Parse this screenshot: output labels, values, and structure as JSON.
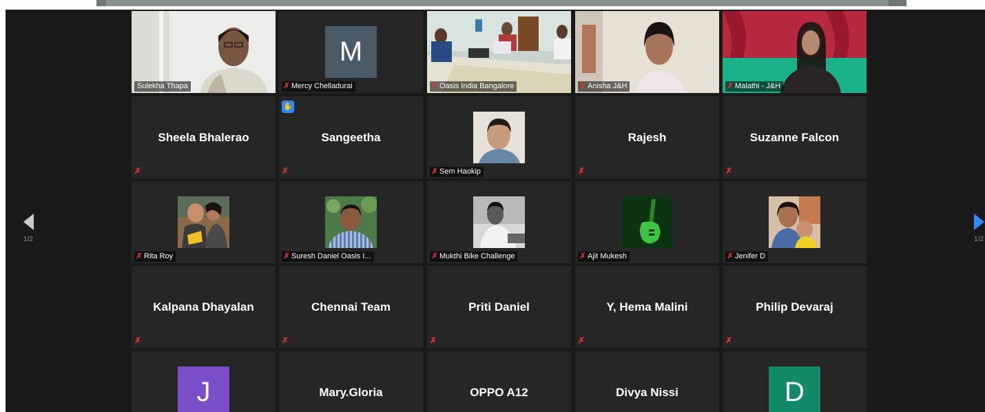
{
  "pager": {
    "left": "1/2",
    "right": "1/2"
  },
  "colors": {
    "accent": "#2d8cff",
    "active_border": "#c7e03a",
    "mic_muted": "#e0312e"
  },
  "tiles": [
    {
      "name": "Sulekha Thapa",
      "kind": "video",
      "active": true
    },
    {
      "name": "Mercy Chelladurai",
      "kind": "avatar",
      "initial": "M",
      "avatar_color": "#4a5a66",
      "muted": true
    },
    {
      "name": "Oasis India Bangalore",
      "kind": "video",
      "muted": true
    },
    {
      "name": "Anisha J&H",
      "kind": "video",
      "muted": true
    },
    {
      "name": "Malathi - J&H",
      "kind": "video",
      "muted": true
    },
    {
      "name": "Sheela Bhalerao",
      "kind": "name",
      "muted": true
    },
    {
      "name": "Sangeetha",
      "kind": "name",
      "muted": true,
      "hand_raised": true
    },
    {
      "name": "Sem Haokip",
      "kind": "photo",
      "muted": true
    },
    {
      "name": "Rajesh",
      "kind": "name",
      "muted": true
    },
    {
      "name": "Suzanne Falcon",
      "kind": "name",
      "muted": true
    },
    {
      "name": "Rita Roy",
      "kind": "photo",
      "muted": true
    },
    {
      "name": "Suresh Daniel Oasis I...",
      "kind": "photo",
      "muted": true
    },
    {
      "name": "Mukthi Bike Challenge",
      "kind": "photo",
      "muted": true
    },
    {
      "name": "Ajit Mukesh",
      "kind": "photo",
      "muted": true
    },
    {
      "name": "Jenifer D",
      "kind": "photo",
      "muted": true
    },
    {
      "name": "Kalpana Dhayalan",
      "kind": "name",
      "muted": true
    },
    {
      "name": "Chennai Team",
      "kind": "name",
      "muted": true
    },
    {
      "name": "Priti Daniel",
      "kind": "name",
      "muted": true
    },
    {
      "name": "Y, Hema Malini",
      "kind": "name",
      "muted": true
    },
    {
      "name": "Philip Devaraj",
      "kind": "name",
      "muted": true
    },
    {
      "name": "",
      "kind": "avatar",
      "initial": "J",
      "avatar_color": "#7b4fc9"
    },
    {
      "name": "Mary.Gloria",
      "kind": "name"
    },
    {
      "name": "OPPO A12",
      "kind": "name"
    },
    {
      "name": "Divya Nissi",
      "kind": "name"
    },
    {
      "name": "",
      "kind": "avatar",
      "initial": "D",
      "avatar_color": "#128a6a"
    }
  ]
}
